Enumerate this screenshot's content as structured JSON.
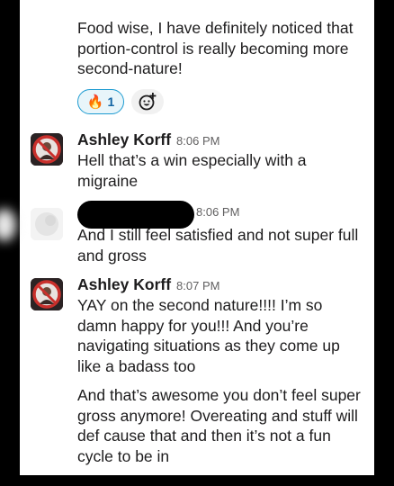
{
  "colors": {
    "text": "#1d1c1d",
    "timestamp": "#616061",
    "reaction_border": "#1d9bd1",
    "reaction_bg": "#e8f5fa",
    "redaction": "#000000"
  },
  "messages_top": {
    "continuation_text": "Food wise, I have definitely noticed that portion-control is really becoming more second-nature!",
    "reaction": {
      "emoji": "🔥",
      "count": "1",
      "icon": "fire-icon"
    },
    "add_reaction_icon": "add-reaction-icon"
  },
  "messages": [
    {
      "author": "Ashley Korff",
      "time": "8:06 PM",
      "avatar": "avatar-ashley",
      "paragraphs": [
        "Hell that’s a win especially with a migraine"
      ]
    },
    {
      "author": "",
      "author_redacted": true,
      "time": "8:06 PM",
      "avatar": "avatar-redacted",
      "paragraphs": [
        "And I still feel satisfied and not super full and gross"
      ]
    },
    {
      "author": "Ashley Korff",
      "time": "8:07 PM",
      "avatar": "avatar-ashley",
      "paragraphs": [
        "YAY on the second nature!!!! I’m so damn happy for you!!! And you’re navigating situations as they come up like a badass too",
        "And that’s awesome you don’t feel super gross anymore! Overeating and stuff will def cause that and then it’s not a fun cycle to be in"
      ]
    }
  ]
}
